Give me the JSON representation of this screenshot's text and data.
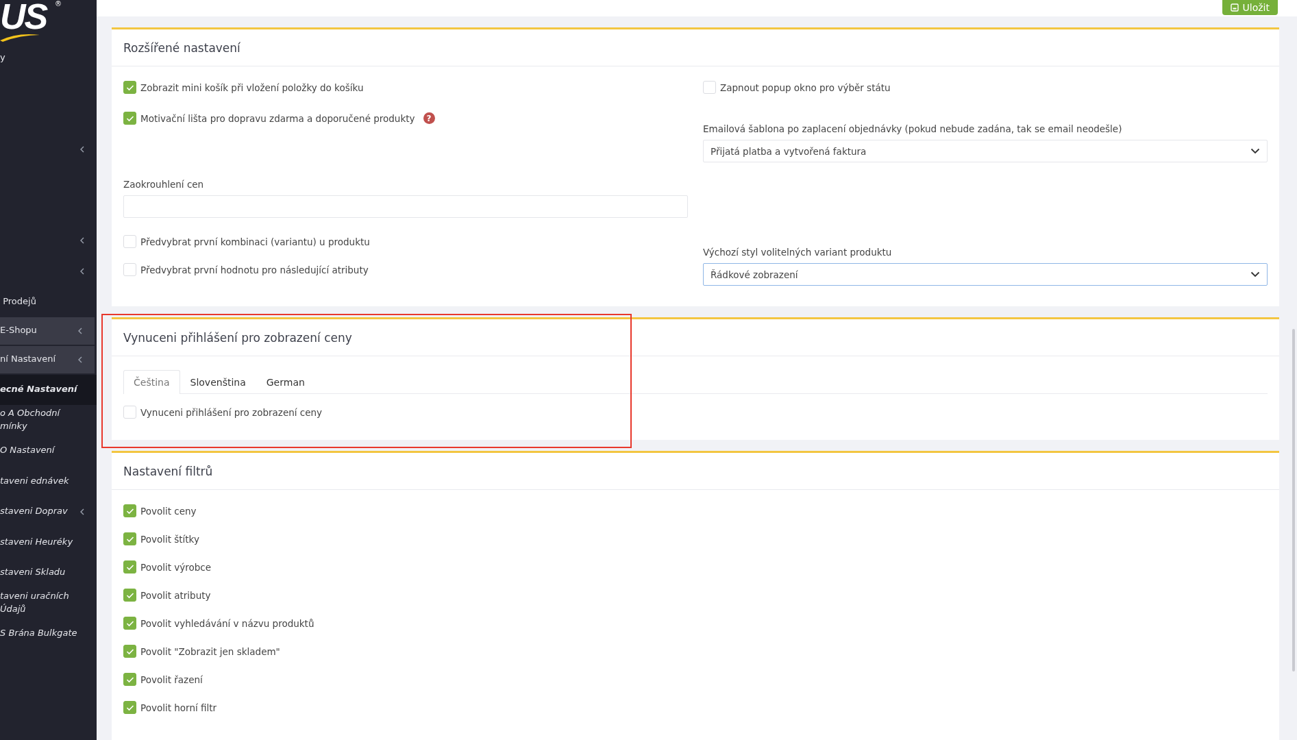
{
  "sidebar": {
    "logo": "US",
    "logo_mark": "®",
    "items": [
      {
        "label": "y",
        "expandable": false,
        "open": false,
        "selected": false
      },
      {
        "expandable": false,
        "open": false,
        "selected": false
      },
      {
        "expandable": false,
        "open": false,
        "selected": false
      },
      {
        "expandable": true,
        "open": false,
        "selected": false
      },
      {
        "expandable": false,
        "open": false,
        "selected": false
      },
      {
        "expandable": false,
        "open": false,
        "selected": false
      },
      {
        "expandable": true,
        "open": false,
        "selected": false
      },
      {
        "expandable": true,
        "open": false,
        "selected": false
      },
      {
        "label": " Prodejů",
        "expandable": false,
        "open": false,
        "selected": false
      },
      {
        "label": "E-Shopu",
        "expandable": true,
        "open": true,
        "selected": false
      },
      {
        "label": "ní Nastavení",
        "expandable": true,
        "open": true,
        "selected": false
      },
      {
        "label": "ecné Nastavení",
        "expandable": false,
        "open": false,
        "selected": true,
        "sub": true
      },
      {
        "label": "o A Obchodní mínky",
        "expandable": false,
        "open": false,
        "selected": false,
        "sub": true
      },
      {
        "label": "O Nastavení",
        "expandable": false,
        "open": false,
        "selected": false,
        "sub": true
      },
      {
        "label": "taveni ednávek",
        "expandable": false,
        "open": false,
        "selected": false,
        "sub": true
      },
      {
        "label": "staveni Doprav",
        "expandable": true,
        "open": false,
        "selected": false,
        "sub": true
      },
      {
        "label": "staveni Heuréky",
        "expandable": false,
        "open": false,
        "selected": false,
        "sub": true
      },
      {
        "label": "staveni Skladu",
        "expandable": false,
        "open": false,
        "selected": false,
        "sub": true
      },
      {
        "label": "taveni uračních Údajů",
        "expandable": false,
        "open": false,
        "selected": false,
        "sub": true
      },
      {
        "label": "S Brána Bulkgate",
        "expandable": false,
        "open": false,
        "selected": false,
        "sub": true
      }
    ]
  },
  "toolbar": {
    "save_button": "Uložit"
  },
  "sections": [
    {
      "title": "Rozšířené nastavení",
      "kind": "columns",
      "highlighted": false,
      "rows": [
        {
          "left": [
            {
              "kind": "checkbox",
              "label": "Zobrazit mini košík při vložení položky do košíku",
              "checked": true
            }
          ],
          "right": [
            {
              "kind": "checkbox",
              "label": "Zapnout popup okno pro výběr státu",
              "checked": false
            }
          ]
        },
        {
          "left": [
            {
              "kind": "checkbox",
              "label": "Motivační lišta pro dopravu zdarma a doporučené produkty",
              "checked": true,
              "help": "?"
            }
          ],
          "right": [
            {
              "kind": "select",
              "label": "Emailová šablona po zaplacení objednávky (pokud nebude zadána, tak se email neodešle)",
              "value": "Přijatá platba a vytvořená faktura",
              "focused": false
            }
          ]
        },
        {
          "left": [
            {
              "kind": "input",
              "label": "Zaokrouhlení cen"
            }
          ],
          "right": []
        },
        {
          "left": [
            {
              "kind": "checkbox",
              "label": "Předvybrat první kombinaci (variantu) u produktu",
              "checked": false
            },
            {
              "kind": "checkbox",
              "label": "Předvybrat první hodnotu pro následující atributy",
              "checked": false
            }
          ],
          "right": [
            {
              "kind": "select",
              "label": "Výchozí styl volitelných variant produktu",
              "value": "Řádkové zobrazení",
              "focused": true
            }
          ]
        }
      ]
    },
    {
      "title": "Vynuceni přihlášení pro zobrazení ceny",
      "kind": "tabs",
      "highlighted": true,
      "tabs": [
        {
          "label": "Čeština",
          "selected": true
        },
        {
          "label": "Slovenština",
          "selected": false
        },
        {
          "label": "German",
          "selected": false
        }
      ],
      "fields": [
        {
          "kind": "checkbox",
          "label": "Vynuceni přihlášení pro zobrazení ceny",
          "checked": false
        }
      ]
    },
    {
      "title": "Nastavení filtrů",
      "kind": "list",
      "highlighted": false,
      "fields": [
        {
          "kind": "checkbox",
          "label": "Povolit ceny",
          "checked": true
        },
        {
          "kind": "checkbox",
          "label": "Povolit štítky",
          "checked": true
        },
        {
          "kind": "checkbox",
          "label": "Povolit výrobce",
          "checked": true
        },
        {
          "kind": "checkbox",
          "label": "Povolit atributy",
          "checked": true
        },
        {
          "kind": "checkbox",
          "label": "Povolit vyhledávání v názvu produktů",
          "checked": true
        },
        {
          "kind": "checkbox",
          "label": "Povolit \"Zobrazit jen skladem\"",
          "checked": true
        },
        {
          "kind": "checkbox",
          "label": "Povolit řazení",
          "checked": true
        },
        {
          "kind": "checkbox",
          "label": "Povolit horní filtr",
          "checked": true
        }
      ]
    }
  ]
}
